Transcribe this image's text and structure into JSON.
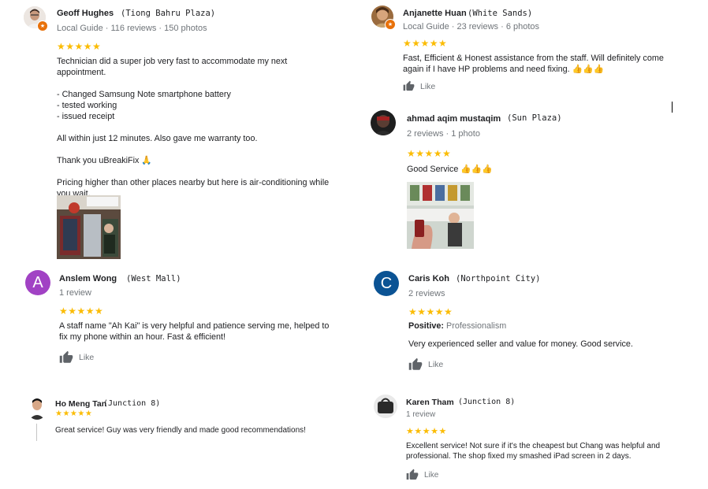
{
  "reviews": {
    "geoff": {
      "name": "Geoff Hughes",
      "location": "(Tiong Bahru Plaza)",
      "meta": "Local Guide · 116 reviews · 150 photos",
      "stars": "★★★★★",
      "rating": 5,
      "text": "Technician did a super job very fast to accommodate my next appointment.\n\n- Changed Samsung Note smartphone battery\n- tested working\n- issued receipt\n\nAll within just 12 minutes. Also gave me warranty too.\n\nThank you uBreakiFix 🙏\n\nPricing higher than other places nearby but here is air-conditioning while you wait."
    },
    "anjanette": {
      "name": "Anjanette Huan",
      "location": "(White Sands)",
      "meta": "Local Guide · 23 reviews · 6 photos",
      "stars": "★★★★★",
      "rating": 5,
      "text": "Fast, Efficient & Honest assistance from the staff. Will definitely come again if I have HP problems and need fixing. 👍👍👍",
      "like": "Like"
    },
    "ahmad": {
      "name": "ahmad aqim mustaqim",
      "location": "(Sun Plaza)",
      "meta": "2 reviews · 1 photo",
      "stars": "★★★★★",
      "rating": 5,
      "text": "Good Service 👍👍👍"
    },
    "anslem": {
      "name": "Anslem Wong",
      "location": "(West Mall)",
      "initial": "A",
      "avatar_color": "#a142c4",
      "meta": "1 review",
      "stars": "★★★★★",
      "rating": 5,
      "text": "A staff name \"Ah Kai\" is very helpful and patience serving me, helped to fix my phone within an hour. Fast & efficient!",
      "like": "Like"
    },
    "caris": {
      "name": "Caris Koh",
      "location": "(Northpoint City)",
      "initial": "C",
      "avatar_color": "#0b5394",
      "meta": "2 reviews",
      "stars": "★★★★★",
      "rating": 5,
      "positive_label": "Positive:",
      "positive_value": "Professionalism",
      "text": "Very experienced seller and value for money. Good service.",
      "like": "Like"
    },
    "homeng": {
      "name": "Ho Meng Tan",
      "location": "(Junction 8)",
      "stars": "★★★★★",
      "rating": 5,
      "text": "Great service! Guy was very friendly and made good recommendations!"
    },
    "karen": {
      "name": "Karen Tham",
      "location": "(Junction 8)",
      "meta": "1 review",
      "stars": "★★★★★",
      "rating": 5,
      "text": "Excellent service! Not sure if it's the cheapest but Chang was helpful and professional. The shop fixed my smashed iPad screen in 2 days.",
      "like": "Like"
    }
  },
  "colors": {
    "star": "#fbbc04",
    "meta": "#70757a",
    "guide_badge": "#e8710a"
  },
  "icons": {
    "like": "thumbs-up-icon",
    "badge": "local-guide-badge-icon"
  }
}
